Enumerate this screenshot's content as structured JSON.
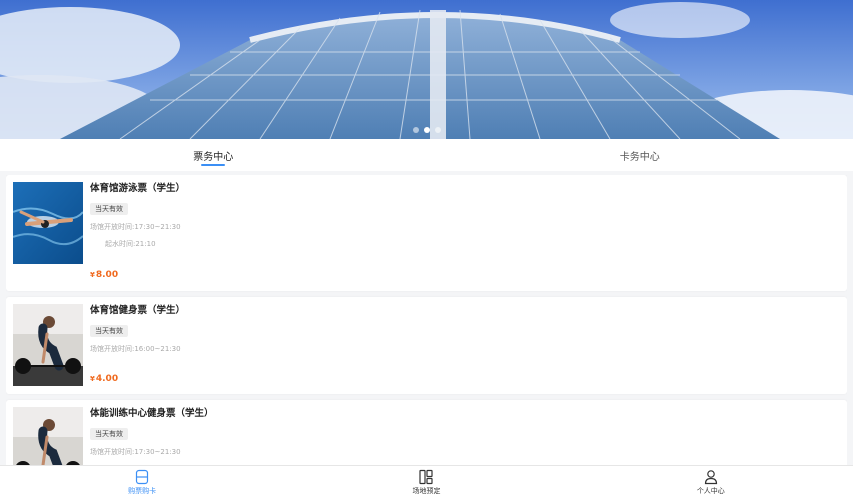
{
  "banner": {
    "slide_count": 3,
    "active_slide": 1
  },
  "tabs": [
    {
      "label": "票务中心",
      "active": true
    },
    {
      "label": "卡务中心",
      "active": false
    }
  ],
  "tickets": [
    {
      "title": "体育馆游泳票（学生）",
      "tag": "当天有效",
      "open_time": "场馆开放时间:17:30~21:30",
      "extra": "起水时间:21:10",
      "currency": "¥",
      "price": "8.00",
      "image": "swimmer"
    },
    {
      "title": "体育馆健身票（学生）",
      "tag": "当天有效",
      "open_time": "场馆开放时间:16:00~21:30",
      "currency": "¥",
      "price": "4.00",
      "image": "weightlifter"
    },
    {
      "title": "体能训练中心健身票（学生）",
      "tag": "当天有效",
      "open_time": "场馆开放时间:17:30~21:30",
      "image": "weightlifter"
    }
  ],
  "bottom_nav": [
    {
      "label": "购票购卡",
      "icon": "ticket-icon",
      "active": true
    },
    {
      "label": "场地预定",
      "icon": "venue-icon",
      "active": false
    },
    {
      "label": "个人中心",
      "icon": "person-icon",
      "active": false
    }
  ],
  "colors": {
    "accent": "#3b8ff5",
    "price": "#f06a1f"
  }
}
